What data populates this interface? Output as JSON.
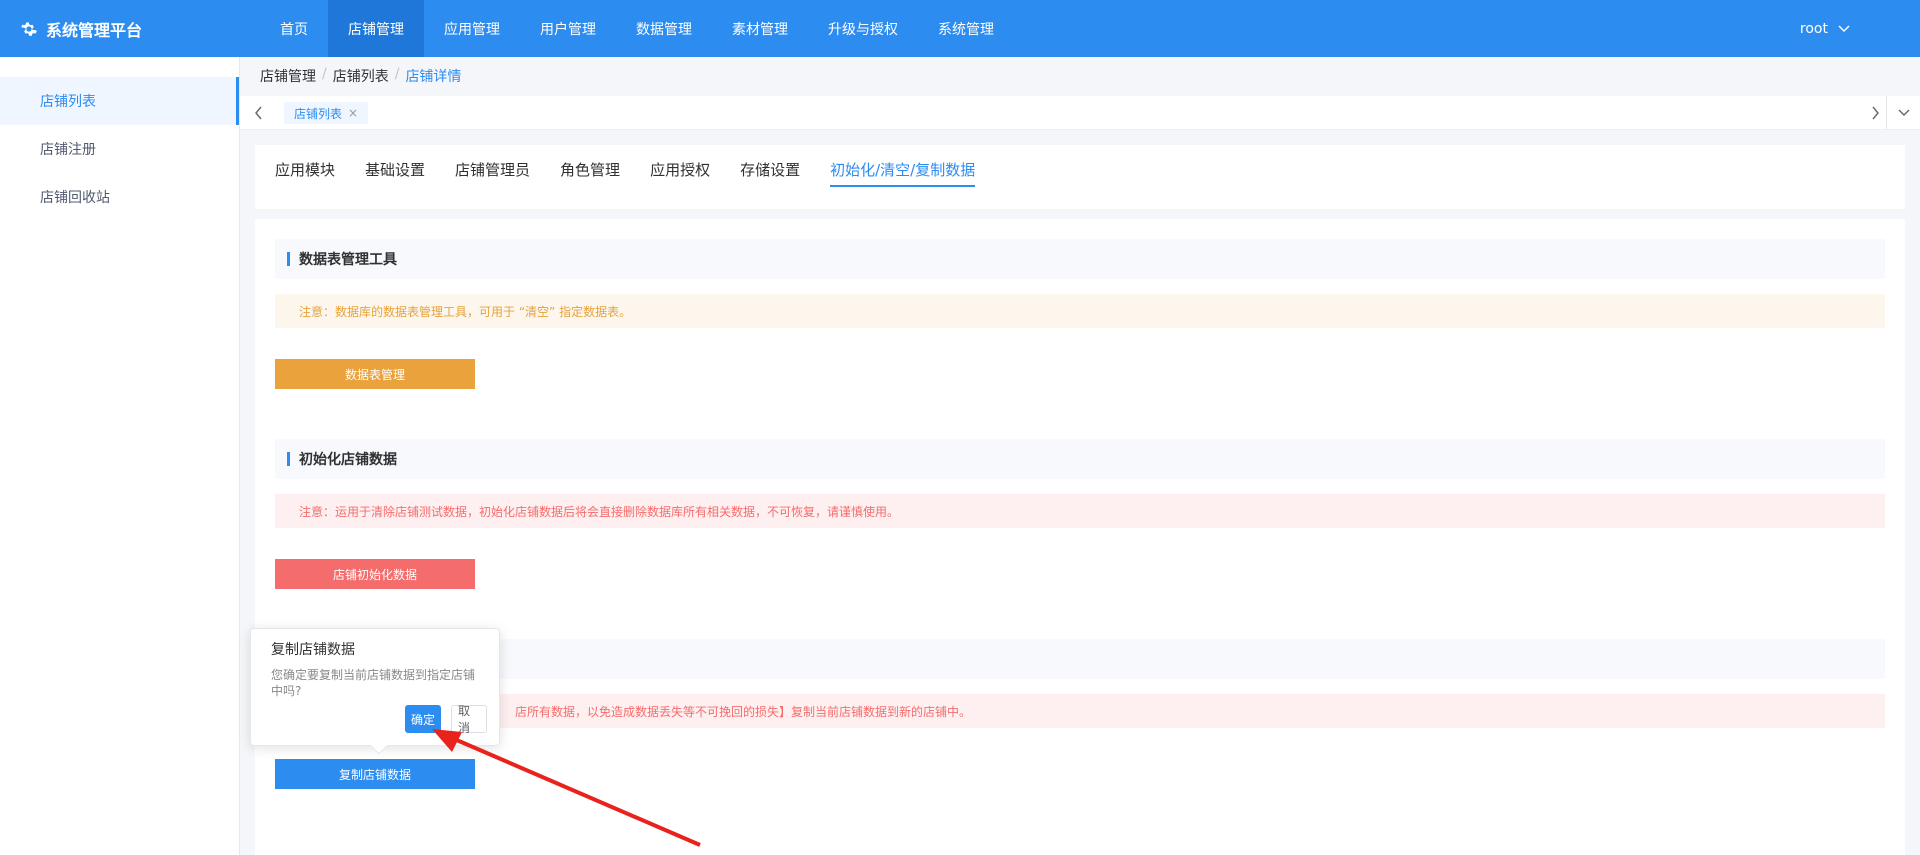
{
  "header": {
    "brand": "系统管理平台",
    "nav": [
      "首页",
      "店铺管理",
      "应用管理",
      "用户管理",
      "数据管理",
      "素材管理",
      "升级与授权",
      "系统管理"
    ],
    "active_nav": "店铺管理",
    "user": "root"
  },
  "sidebar": {
    "items": [
      {
        "label": "店铺列表"
      },
      {
        "label": "店铺注册"
      },
      {
        "label": "店铺回收站"
      }
    ]
  },
  "breadcrumb": [
    "店铺管理",
    "店铺列表",
    "店铺详情"
  ],
  "tagbar": {
    "tag": "店铺列表",
    "close": "×"
  },
  "tabs": [
    "应用模块",
    "基础设置",
    "店铺管理员",
    "角色管理",
    "应用授权",
    "存储设置",
    "初始化/清空/复制数据"
  ],
  "sections": [
    {
      "title": "数据表管理工具",
      "notice": "注意：数据库的数据表管理工具，可用于 “清空” 指定数据表。",
      "button": "数据表管理"
    },
    {
      "title": "初始化店铺数据",
      "notice": "注意：运用于清除店铺测试数据，初始化店铺数据后将会直接删除数据库所有相关数据，不可恢复，请谨慎使用。",
      "button": "店铺初始化数据"
    },
    {
      "title": "",
      "notice": "店所有数据，以免造成数据丢失等不可挽回的损失】复制当前店铺数据到新的店铺中。",
      "button": "复制店铺数据"
    }
  ],
  "popover": {
    "title": "复制店铺数据",
    "text": "您确定要复制当前店铺数据到指定店铺中吗?",
    "confirm": "确定",
    "cancel": "取消"
  },
  "colors": {
    "primary": "#2d8cf0",
    "warn": "#e6a23c",
    "danger": "#f56c6c",
    "annotation": "#e8231d"
  }
}
